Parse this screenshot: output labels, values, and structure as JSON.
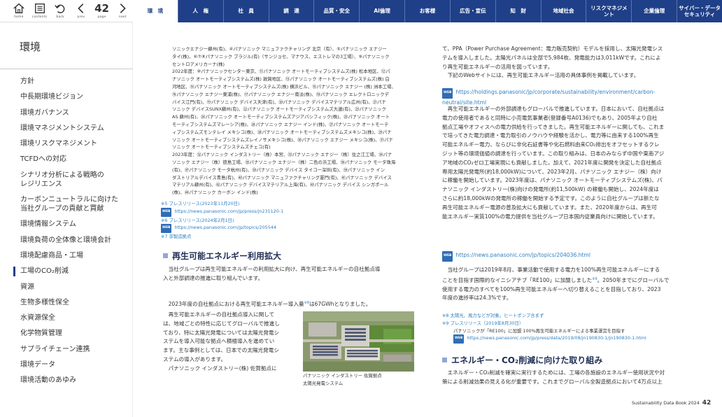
{
  "nav": {
    "home": "home",
    "contents": "contents",
    "back": "back",
    "prev": "prev",
    "page_label": "page",
    "next": "next",
    "page": "42"
  },
  "tabs": [
    "環　境",
    "人　権",
    "社　員",
    "調　達",
    "品質・安全",
    "AI倫理",
    "お客様",
    "広告・宣伝",
    "知　財",
    "地域社会",
    "リスクマネジメント",
    "企業倫理",
    "サイバー・データ\nセキュリティ"
  ],
  "sidebar": {
    "title": "環境",
    "items": [
      "方針",
      "中長期環境ビジョン",
      "環境ガバナンス",
      "環境マネジメントシステム",
      "環境リスクマネジメント",
      "TCFDへの対応",
      "シナリオ分析による戦略の\nレジリエンス",
      "カーボンニュートラルに向けた\n当社グループの貢献と買献",
      "環境情報システム",
      "環境負荷の全体像と環境会計",
      "環境配慮商品・工場",
      "工場のCO₂削減",
      "資源",
      "生物多様性保全",
      "水資源保全",
      "化学物質管理",
      "サプライチェーン連携",
      "環境データ",
      "環境活動のあゆみ"
    ],
    "active_index": 11
  },
  "left": {
    "list_lines": [
      "ソニックエナジー蘇州(有)、④パナソニック マニュファクチャリング 北京（有）、⑤パナソニック エナジー",
      "タイ(株)、⑥⑦⑧パナソニック ブラジル(有)（サンジョセ、マナウス、エストレマの3工場）、⑨パナソニック",
      "セントロアメリカーナ(株)",
      "2022年度：⑩パナソニックセンター東京、⑪パナソニック オートモーティブシステムズ(株) 松本地区、⑫パ",
      "ナソニック オートモーティブシステムズ(株) 敦賀地区、⑬パナソニック オートモーティブシステムズ(株) 白",
      "河地区、⑭パナソニック オートモーティブシステムズ(株) 横浜ビル、⑮パナソニック エナジー (株) 洲本工場、",
      "⑯パナソニック エナジー東浦(株)、⑰パナソニック エナジー南淡(株)、⑱パナソニック エレクトロニックデ",
      "バイス江門(有)、⑲パナソニック デバイス天津(有)、⑳パナソニック デバイスマテリアル広州(有)、㉑パナ",
      "ソニック デバイスSUNX蘇州(有)、㉒パナソニック オートモーティブシステムズ大連(有)、㉓パナソニック",
      "AS 蘇州(有)、㉔パナソニック オートモーティブシステムズアジアパシフィック(株)、㉕パナソニック オート",
      "モーティブシステムズマレーシア(株)、㉖パナソニック エナジー インド(株)、㉗パナソニック オートモーテ",
      "ィブシステムズモンテレイ メキシコ(株)、㉘パナソニック オートモーティブシステムズメキシコ(株)、㉙パナ",
      "ソニック オートモーティブシステムズレイノサメキシコ(株)、㉚パナソニック エナジー メキシコ(株)、㉛パナ",
      "ソニック オートモーティブシステムズチェコ(有)",
      "2023年度：㉜パナソニック インダストリー（株）本宮、㉝パナソニック エナジー（株）住之江工場、㉞パナ",
      "ソニック エナジー（株）徳島工場、㉟パナソニック エナジー（株）二色の浜工場、㊱パナソニック モータ珠海",
      "(有)、㊲パナソニック モータ杭州(有)、㊳パナソニック デバイス タイコー深圳(有)、㊴パナソニック イン",
      "ダストリアルデバイス青島(有)、㊵パナソニック マニュファクチャリング厦門(有)、㊶パナソニック デバイス",
      "マテリアル蘇州(有)、㊷パナソニック デバイスマテリアル上海(有)、㊸パナソニック デバイス シンガポール",
      "(株)、㊹パナソニック カーボン インド(株)"
    ],
    "note5": "※5 プレスリリース(2023年11月20日)",
    "note5_url": "https://news.panasonic.com/jp/press/jn231120-1",
    "note6": "※6 プレスリリース(2024年2月1日)",
    "note6_url": "https://news.panasonic.com/jp/topics/205544",
    "note7": "※7 非製造拠点",
    "heading": "再生可能エネルギー利用拡大",
    "p1": [
      "　当社グループは再生可能エネルギーの利用拡大に向け、再生可能エネルギーの自社拠点導",
      "入と外部調達の推進に取り組んでいます。"
    ],
    "p2a": "　2023年度の自社拠点における再生可能エネルギー導入量",
    "p2sup": "※8",
    "p2b": "は67GWhとなりました。",
    "p3": [
      "　再生可能エネルギーの自社拠点導入に関して",
      "は、地域ごとの特性に応じてグローバルで推進し",
      "ており、特に太陽光発電については太陽光発電シ",
      "ステムを導入可能な拠点へ積極導入を進めてい",
      "ます。主な事例としては、日本での太陽光発電シ",
      "ステムの導入があります。",
      "　パナソニック インダストリー(株) 佐賀拠点に"
    ],
    "caption": [
      "パナソニック インダストリー 佐賀拠点",
      "太陽光発電システム"
    ]
  },
  "right": {
    "p1": [
      "て、PPA（Power Purchase Agreement：電力販売契約）モデルを採用し、太陽光発電シス",
      "テムを導入しました。太陽光パネルは全部で5,984枚、発電能力は3,011kWです。これによ",
      "り再生可能エネルギーの活用を図っています。",
      "　下記のWebサイトには、再生可能エネルギー活用の具体事例を掲載しています。"
    ],
    "url1": "https://holdings.panasonic/jp/corporate/sustainability/environment/carbon-neutral/site.html",
    "p2": [
      "　再生可能エネルギーの外部調達もグローバルで推進しています。日本において、自社拠点は",
      "電力の使用者であると同時に小売電気事業者(登録番号A0136)でもあり、2005年より自社",
      "拠点工場やオフィスへの電力供給を行ってきました。再生可能エネルギーに関しても、これま",
      "で培ってきた電力調達・電力取引のノウハウや経験を活かし、電力等に由来する100%再生",
      "可能エネルギー電力、ならびに非化石証書等や化石燃料由来CO₂排出をオフセットするクレ",
      "ジット等の環境価値の調達を行っています。この取り組みは、日本のみならず中国や東南アジ",
      "ア地域のCO₂ゼロ工場実現にも貢献しました。加えて、2021年度に開発を決定した自社拠点",
      "専用太陽光発電所(約18,000kW)について、2023年2月、パナソニック エナジー（株）向け",
      "に稼働を開始しています。2023年度は、パナソニック オートモーティブシステムズ(株)、パ",
      "ナソニック インダストリー(株)向けの発電所(約11,500kW) の稼働も開始し、2024年度は",
      "さらに約18,000kWの発電所の稼働を開始する予定です。このように自社グループは新たな",
      "再生可能エネルギー電源の普及拡大にも貢献しています。また、2020年度からは、再生可",
      "能エネルギー実質100%の電力提供を当社グループ日本国内従業員向けに開始しています。"
    ],
    "url2": "https://news.panasonic.com/jp/topics/204036.html",
    "p3": [
      "　当社グループは2019年8月、事業活動で使用する電力を100%再生可能エネルギーにする",
      "ことを目指す国際的なイニシアチブ「RE100」に加盟しました",
      "。2050年までにグローバルで",
      "使用する電力のすべてを100%再生可能エネルギーへ切り替えることを目指しており、2023",
      "年度の進捗率は24.3%です。"
    ],
    "p3sup": "※9",
    "note8": "※8 太陽光、風力などが対象。ヒートポンプ含まず",
    "note9": "※9 プレスリリース（2019年8月30日）",
    "note9b": "パナソニックが「RE100」に加盟 100%再生可能エネルギーによる事業運営を目指す",
    "url3": "https://news.panasonic.com/jp/press/data/2019/08/jn190830-1/jn190830-1.html",
    "heading2": "エネルギー・CO₂削減に向けた取り組み",
    "p4": [
      "　エネルギー・CO₂削減を確実に実行するためには、工場の各施設のエネルギー使用状況や対",
      "策による削減効果の見える化が重要です。これまでグローバル全製造拠点において4万点以上"
    ]
  },
  "footer": {
    "book": "Sustainability Data Book 2024",
    "page": "42"
  },
  "web_badge": "WEB"
}
